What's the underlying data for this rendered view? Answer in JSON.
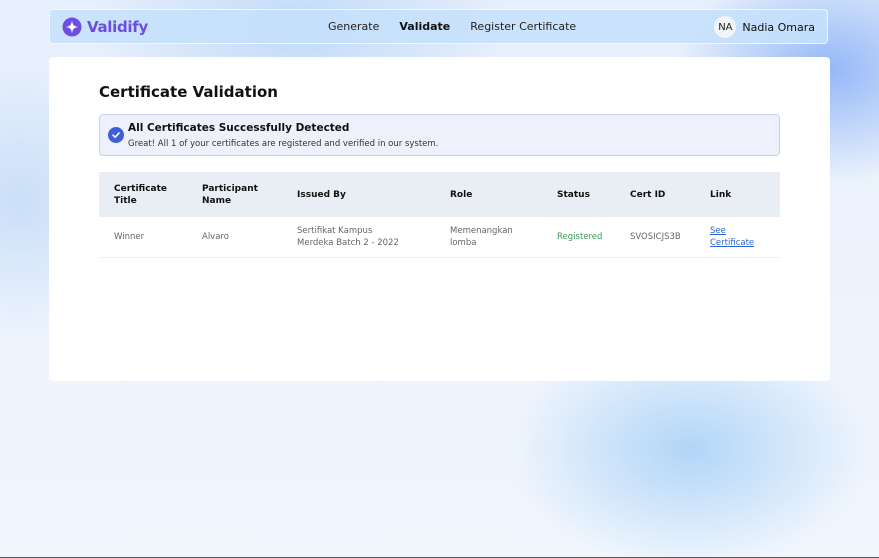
{
  "brand": {
    "name": "Validify",
    "color": "#6d4ee0"
  },
  "nav": {
    "links": [
      {
        "label": "Generate",
        "active": false
      },
      {
        "label": "Validate",
        "active": true
      },
      {
        "label": "Register Certificate",
        "active": false
      }
    ]
  },
  "user": {
    "initials": "NA",
    "name": "Nadia Omara"
  },
  "page": {
    "title": "Certificate Validation"
  },
  "alert": {
    "icon": "check-circle-icon",
    "title": "All Certificates Successfully Detected",
    "message": "Great! All 1 of your certificates are registered and verified in our system."
  },
  "table": {
    "headers": [
      "Certificate Title",
      "Participant Name",
      "Issued By",
      "Role",
      "Status",
      "Cert ID",
      "Link"
    ],
    "rows": [
      {
        "title": "Winner",
        "participant": "Alvaro",
        "issued_by": "Sertifikat Kampus Merdeka Batch 2 - 2022",
        "role": "Memenangkan lomba",
        "status": "Registered",
        "cert_id": "SVOSICJS3B",
        "link": "See Certificate"
      }
    ]
  },
  "colors": {
    "accent": "#3f5fd6",
    "status_registered": "#3a9a5a",
    "link": "#2a63d6"
  }
}
